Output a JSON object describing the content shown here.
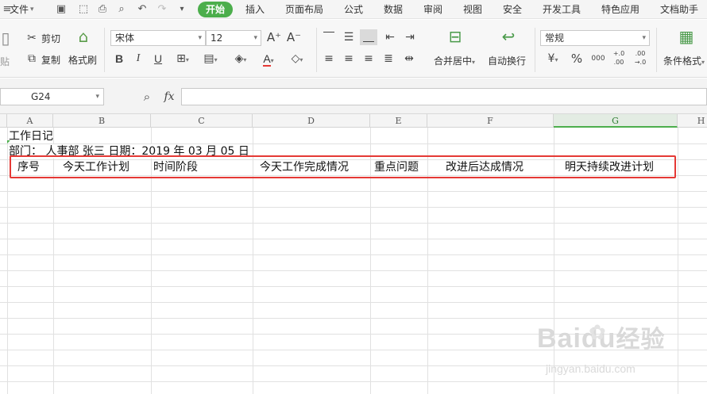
{
  "menubar": {
    "file_label": "文件",
    "tabs": [
      "开始",
      "插入",
      "页面布局",
      "公式",
      "数据",
      "审阅",
      "视图",
      "安全",
      "开发工具",
      "特色应用",
      "文档助手"
    ],
    "active_tab": "开始",
    "accent": "#4cae4c"
  },
  "ribbon": {
    "paste_label": "贴",
    "cut_label": "剪切",
    "copy_label": "复制",
    "format_painter_label": "格式刷",
    "font_name": "宋体",
    "font_size": "12",
    "merge_label": "合并居中",
    "wrap_label": "自动换行",
    "number_format": "常规",
    "conditional_format_label": "条件格式",
    "bold": "B",
    "italic": "I",
    "underline": "U",
    "font_color_letter": "A",
    "grow_font": "A⁺",
    "shrink_font": "A⁻",
    "percent": "%",
    "thousands": "000",
    "inc_decimal": "+.0 .00",
    "dec_decimal": ".00 →.0"
  },
  "formula_bar": {
    "name_box": "G24",
    "fx_label": "fx",
    "formula": ""
  },
  "sheet": {
    "columns": [
      "A",
      "B",
      "C",
      "D",
      "E",
      "F",
      "G",
      "H"
    ],
    "selected_column": "G",
    "title_cell": "工作日记",
    "info_cell": "部门：  人事部   张三      日期：2019 年 03 月 05 日",
    "header_row": [
      "序号",
      "今天工作计划",
      "时间阶段",
      "今天工作完成情况",
      "重点问题",
      "改进后达成情况",
      "明天持续改进计划"
    ],
    "highlight_color": "#e53935"
  },
  "watermark": {
    "brand": "Baidu",
    "brand_cn": "经验",
    "url": "jingyan.baidu.com"
  }
}
